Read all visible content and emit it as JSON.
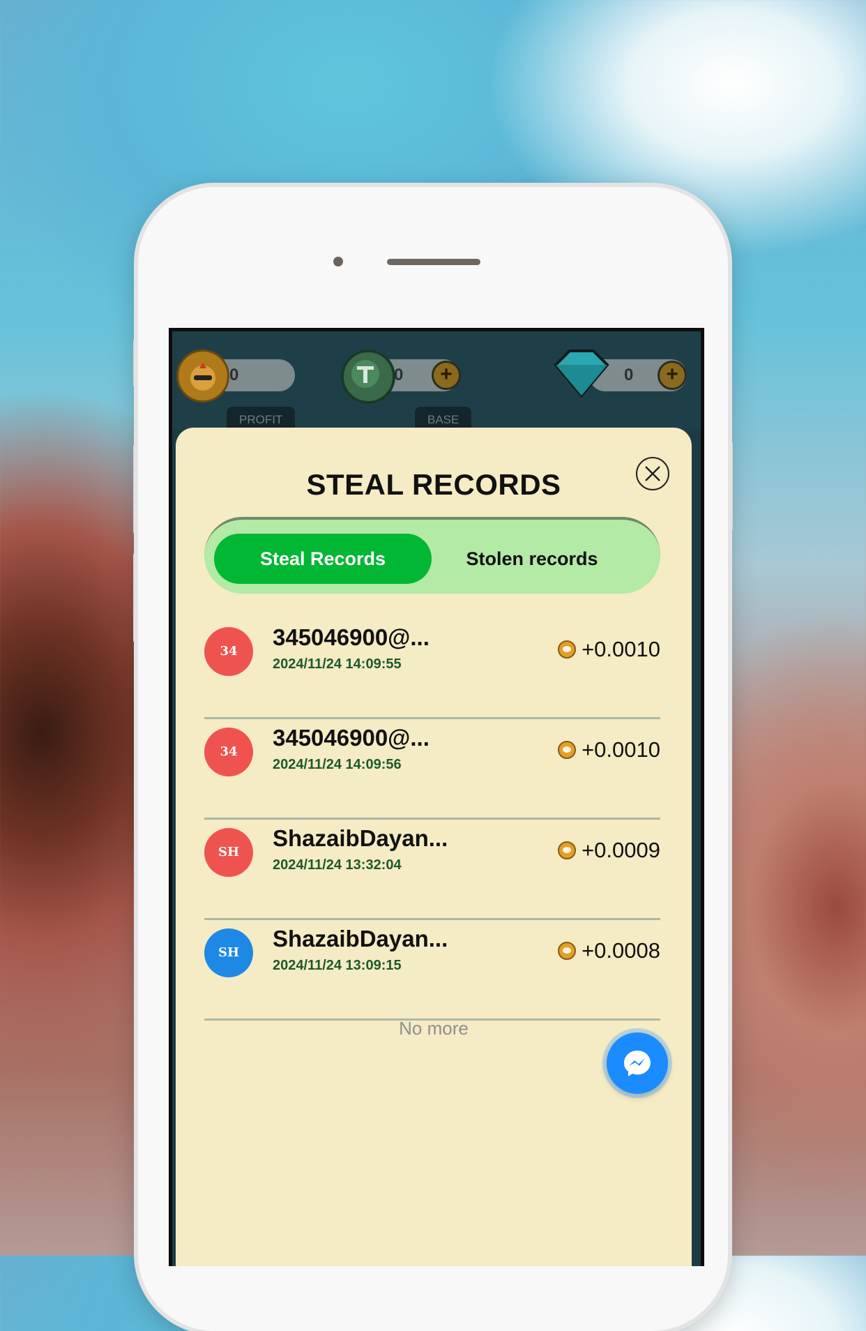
{
  "header": {
    "profit": {
      "value": "0",
      "label": "PROFIT"
    },
    "base": {
      "value": "0",
      "label": "BASE"
    },
    "gems": {
      "value": "0"
    }
  },
  "modal": {
    "title": "STEAL RECORDS",
    "tabs": [
      {
        "label": "Steal Records",
        "active": true
      },
      {
        "label": "Stolen records",
        "active": false
      }
    ],
    "records": [
      {
        "avatar": "34",
        "avatar_color": "#ef5350",
        "name": "345046900@...",
        "time": "2024/11/24 14:09:55",
        "amount": "+0.0010"
      },
      {
        "avatar": "34",
        "avatar_color": "#ef5350",
        "name": "345046900@...",
        "time": "2024/11/24 14:09:56",
        "amount": "+0.0010"
      },
      {
        "avatar": "SH",
        "avatar_color": "#ef5350",
        "name": "ShazaibDayan...",
        "time": "2024/11/24 13:32:04",
        "amount": "+0.0009"
      },
      {
        "avatar": "SH",
        "avatar_color": "#1e88e5",
        "name": "ShazaibDayan...",
        "time": "2024/11/24 13:09:15",
        "amount": "+0.0008"
      }
    ],
    "footer": "No more"
  },
  "icons": {
    "close": "close-circle-icon",
    "coin": "coin-icon",
    "messenger": "messenger-icon"
  },
  "colors": {
    "accent_green": "#02b734",
    "tab_bg": "#b2eaa6",
    "sheet_bg": "#f5ebc4",
    "messenger_blue": "#1a8cff"
  }
}
